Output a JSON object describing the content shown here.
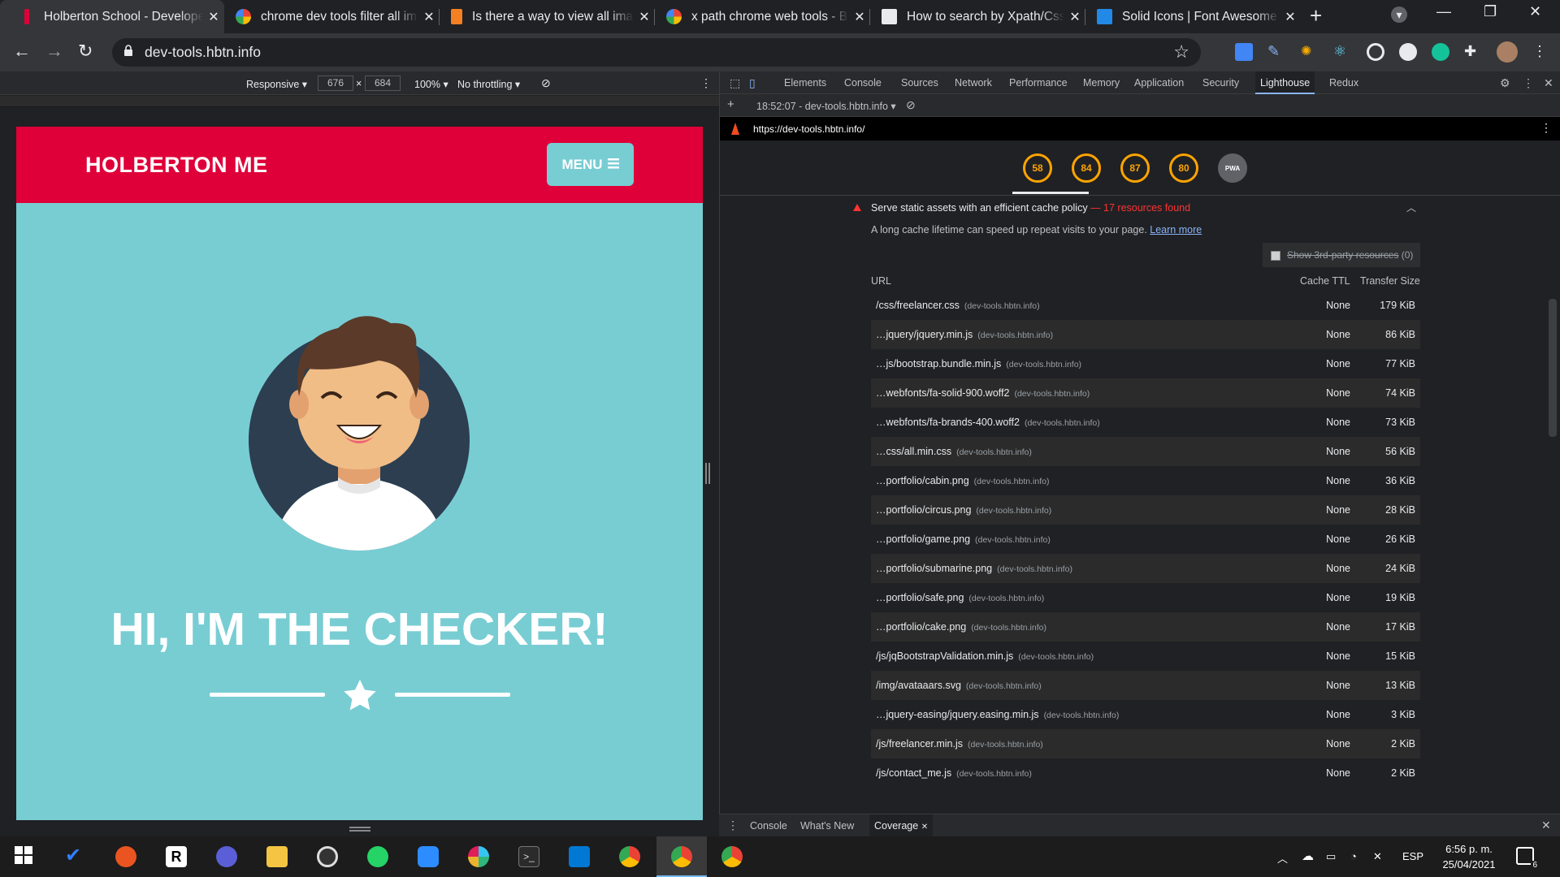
{
  "tabs": [
    {
      "title": "Holberton School - Developer",
      "active": true
    },
    {
      "title": "chrome dev tools filter all im",
      "active": false
    },
    {
      "title": "Is there a way to view all ima",
      "active": false
    },
    {
      "title": "x path chrome web tools - B",
      "active": false
    },
    {
      "title": "How to search by Xpath/Css",
      "active": false
    },
    {
      "title": "Solid Icons | Font Awesome",
      "active": false
    }
  ],
  "address": {
    "url": "dev-tools.hbtn.info"
  },
  "device_toolbar": {
    "mode": "Responsive ▾",
    "width": "676",
    "times": "×",
    "height": "684",
    "zoom": "100% ▾",
    "throttle": "No throttling ▾"
  },
  "site": {
    "brand": "HOLBERTON ME",
    "menu": "MENU",
    "hero": "HI, I'M THE CHECKER!"
  },
  "devtools": {
    "tabs": [
      "Elements",
      "Console",
      "Sources",
      "Network",
      "Performance",
      "Memory",
      "Application",
      "Security",
      "Lighthouse",
      "Redux"
    ],
    "active_tab": "Lighthouse",
    "report_select": "18:52:07 - dev-tools.hbtn.info ▾",
    "report_url": "https://dev-tools.hbtn.info/",
    "scores": [
      "58",
      "84",
      "87",
      "80"
    ],
    "pwa_label": "PWA",
    "audit": {
      "title": "Serve static assets with an efficient cache policy",
      "found": "— 17 resources found",
      "description": "A long cache lifetime can speed up repeat visits to your page.",
      "learn_more": "Learn more",
      "third_party": "Show 3rd-party resources",
      "third_party_count": "(0)",
      "col_url": "URL",
      "col_ttl": "Cache TTL",
      "col_size": "Transfer Size",
      "rows": [
        {
          "url": "/css/freelancer.css",
          "domain": "(dev-tools.hbtn.info)",
          "ttl": "None",
          "size": "179 KiB"
        },
        {
          "url": "…jquery/jquery.min.js",
          "domain": "(dev-tools.hbtn.info)",
          "ttl": "None",
          "size": "86 KiB"
        },
        {
          "url": "…js/bootstrap.bundle.min.js",
          "domain": "(dev-tools.hbtn.info)",
          "ttl": "None",
          "size": "77 KiB"
        },
        {
          "url": "…webfonts/fa-solid-900.woff2",
          "domain": "(dev-tools.hbtn.info)",
          "ttl": "None",
          "size": "74 KiB"
        },
        {
          "url": "…webfonts/fa-brands-400.woff2",
          "domain": "(dev-tools.hbtn.info)",
          "ttl": "None",
          "size": "73 KiB"
        },
        {
          "url": "…css/all.min.css",
          "domain": "(dev-tools.hbtn.info)",
          "ttl": "None",
          "size": "56 KiB"
        },
        {
          "url": "…portfolio/cabin.png",
          "domain": "(dev-tools.hbtn.info)",
          "ttl": "None",
          "size": "36 KiB"
        },
        {
          "url": "…portfolio/circus.png",
          "domain": "(dev-tools.hbtn.info)",
          "ttl": "None",
          "size": "28 KiB"
        },
        {
          "url": "…portfolio/game.png",
          "domain": "(dev-tools.hbtn.info)",
          "ttl": "None",
          "size": "26 KiB"
        },
        {
          "url": "…portfolio/submarine.png",
          "domain": "(dev-tools.hbtn.info)",
          "ttl": "None",
          "size": "24 KiB"
        },
        {
          "url": "…portfolio/safe.png",
          "domain": "(dev-tools.hbtn.info)",
          "ttl": "None",
          "size": "19 KiB"
        },
        {
          "url": "…portfolio/cake.png",
          "domain": "(dev-tools.hbtn.info)",
          "ttl": "None",
          "size": "17 KiB"
        },
        {
          "url": "/js/jqBootstrapValidation.min.js",
          "domain": "(dev-tools.hbtn.info)",
          "ttl": "None",
          "size": "15 KiB"
        },
        {
          "url": "/img/avataaars.svg",
          "domain": "(dev-tools.hbtn.info)",
          "ttl": "None",
          "size": "13 KiB"
        },
        {
          "url": "…jquery-easing/jquery.easing.min.js",
          "domain": "(dev-tools.hbtn.info)",
          "ttl": "None",
          "size": "3 KiB"
        },
        {
          "url": "/js/freelancer.min.js",
          "domain": "(dev-tools.hbtn.info)",
          "ttl": "None",
          "size": "2 KiB"
        },
        {
          "url": "/js/contact_me.js",
          "domain": "(dev-tools.hbtn.info)",
          "ttl": "None",
          "size": "2 KiB"
        }
      ]
    },
    "drawer": {
      "tabs": [
        "Console",
        "What's New",
        "Coverage"
      ],
      "active": "Coverage"
    }
  },
  "taskbar": {
    "lang": "ESP",
    "time": "6:56 p. m.",
    "date": "25/04/2021",
    "notifications": "6"
  },
  "colors": {
    "header_red": "#df0039",
    "teal": "#78cdd3",
    "score_orange": "#ffa400",
    "fail_red": "#ff3333",
    "link_blue": "#8ab4f8"
  }
}
